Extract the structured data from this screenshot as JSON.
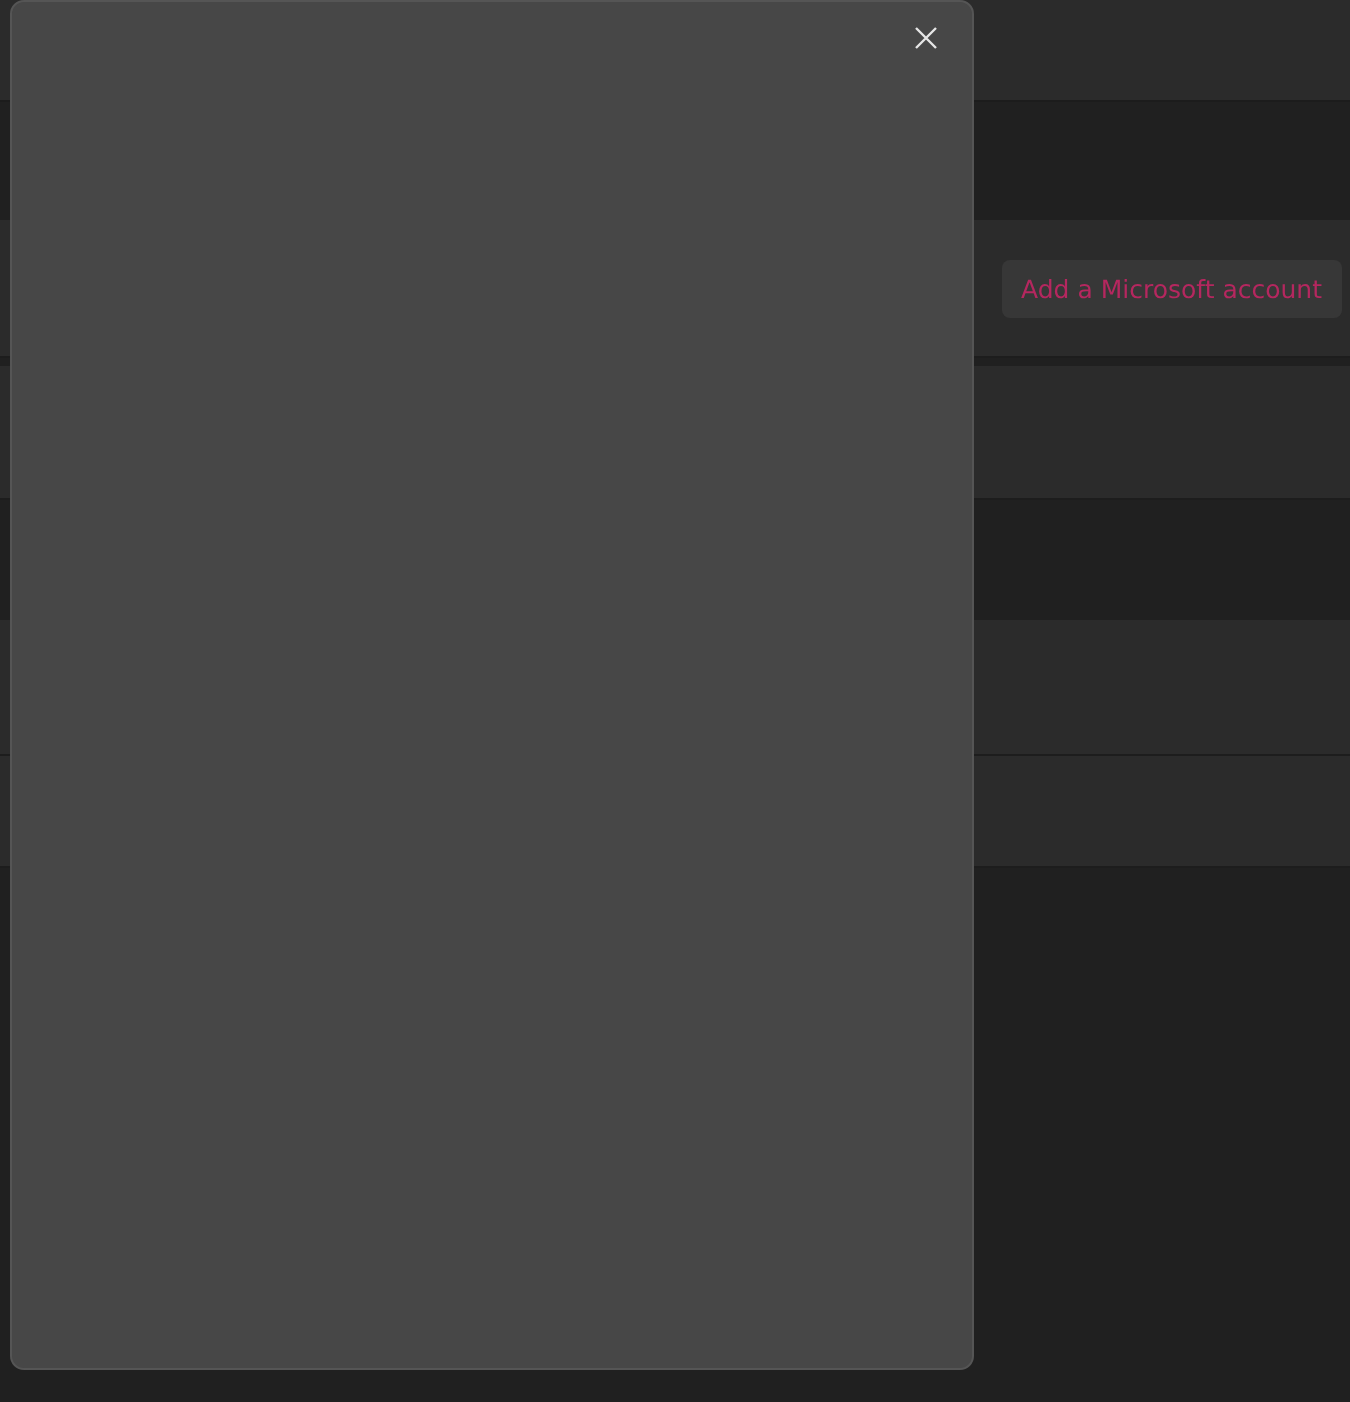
{
  "settings_page": {
    "account_button": "Add a Microsoft account"
  }
}
